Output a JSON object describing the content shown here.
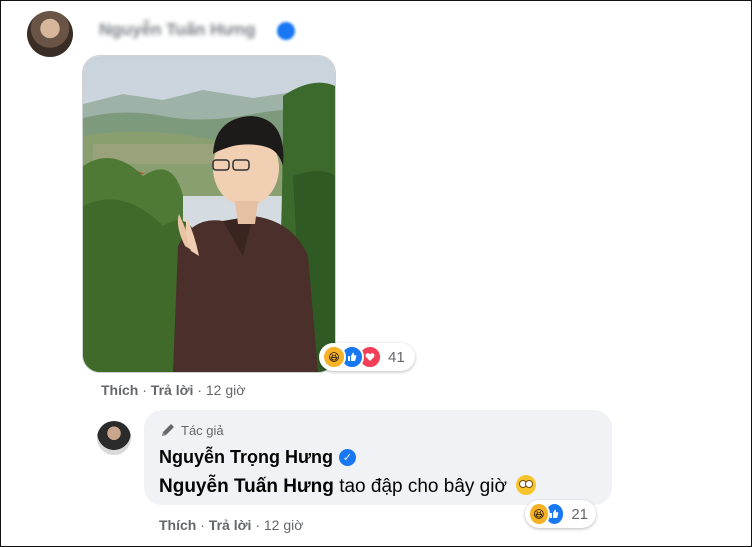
{
  "comment": {
    "author": "Nguyễn Tuấn Hưng",
    "verified_icon": "verified-badge-icon",
    "photo_description_icon": "photo-attachment",
    "reactions": {
      "icons": [
        "haha-icon",
        "like-icon",
        "love-icon"
      ],
      "count": "41"
    },
    "actions": {
      "like": "Thích",
      "separator": "·",
      "reply": "Trả lời",
      "time": "12 giờ"
    }
  },
  "reply": {
    "badge": "Tác giả",
    "badge_icon": "pen-icon",
    "author": "Nguyễn Trọng Hưng",
    "mention": "Nguyễn Tuấn Hưng",
    "text": "tao đập cho bây giờ",
    "emoji_icon": "eye-roll-emoji-icon",
    "reactions": {
      "icons": [
        "haha-icon",
        "like-icon"
      ],
      "count": "21"
    },
    "actions": {
      "like": "Thích",
      "separator": "·",
      "reply": "Trả lời",
      "time": "12 giờ"
    }
  },
  "colors": {
    "accent": "#1877f2",
    "bubble": "#f0f2f5",
    "meta": "#65676b",
    "haha": "#f7b125",
    "love": "#f33e58"
  }
}
